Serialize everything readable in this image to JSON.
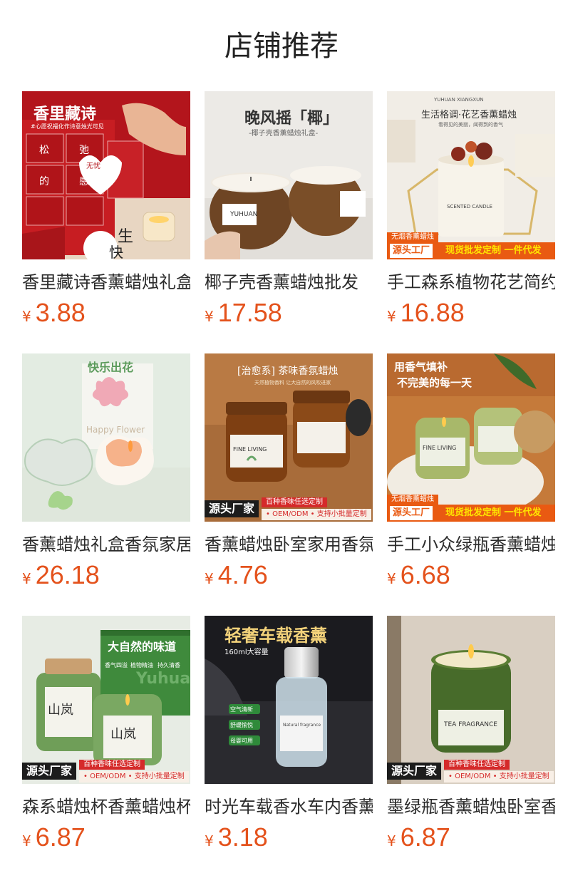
{
  "page": {
    "title": "店铺推荐"
  },
  "currency_symbol": "¥",
  "products": [
    {
      "name": "香里藏诗香薰蜡烛礼盒",
      "price": "3.88",
      "image": {
        "title": "香里藏诗",
        "subtitle": "#心愿祝福化作诗意烛光可见",
        "tiles": [
          "松",
          "弛",
          "的",
          "感",
          "无忧",
          "生",
          "快"
        ]
      }
    },
    {
      "name": "椰子壳香薰蜡烛批发",
      "price": "17.58",
      "image": {
        "title": "晚风摇「椰」",
        "subtitle": "-椰子壳香薰蜡烛礼盒-",
        "jar_label": "YUHUAN"
      }
    },
    {
      "name": "手工森系植物花艺简约",
      "price": "16.88",
      "image": {
        "top_text": "YUHUAN XIANGXUN",
        "title": "生活格调·花艺香薰蜡烛",
        "subtitle": "看得见的美丽，闻得到的香气",
        "jar_label": "SCENTED CANDLE",
        "tag_small": "无烟香薰蜡烛",
        "tag_white": "源头工厂",
        "tag_yellow": "现货批发定制 一件代发"
      }
    },
    {
      "name": "香薰蜡烛礼盒香氛家居",
      "price": "26.18",
      "image": {
        "box_text": "快乐出花",
        "box_en": "Happy Flower"
      }
    },
    {
      "name": "香薰蜡烛卧室家用香氛",
      "price": "4.76",
      "image": {
        "title": "[治愈系] 茶味香氛蜡烛",
        "subtitle": "天然植物香料 让大自然的风吹进家",
        "jar_label": "FINE LIVING",
        "tag_factory": "源头厂家",
        "tag_red": "百种香味任选定制",
        "tag_sub": "• OEM/ODM • 支持小批量定制"
      }
    },
    {
      "name": "手工小众绿瓶香薰蜡烛",
      "price": "6.68",
      "image": {
        "title": "用香气填补",
        "title2": "不完美的每一天",
        "jar_label": "FINE LIVING",
        "tag_small": "无烟香薰蜡烛",
        "tag_white": "源头工厂",
        "tag_yellow": "现货批发定制 一件代发"
      }
    },
    {
      "name": "森系蜡烛杯香薰蜡烛杯",
      "price": "6.87",
      "image": {
        "title": "大自然的味道",
        "chips": [
          "香气四溢",
          "植物精油",
          "持久清香"
        ],
        "jar_label": "山岚",
        "box_text": "Yuhuan",
        "tag_factory": "源头厂家",
        "tag_red": "百种香味任选定制",
        "tag_sub": "• OEM/ODM • 支持小批量定制"
      }
    },
    {
      "name": "时光车载香水车内香薰",
      "price": "3.18",
      "image": {
        "title": "轻奢车载香薰",
        "subtitle": "160ml大容量",
        "chips": [
          "空气清新",
          "舒缓愉悦",
          "母婴可用"
        ],
        "bottle_label": "Natural fragrance"
      }
    },
    {
      "name": "墨绿瓶香薰蜡烛卧室香",
      "price": "6.87",
      "image": {
        "jar_label": "TEA FRAGRANCE",
        "tag_factory": "源头厂家",
        "tag_red": "百种香味任选定制",
        "tag_sub": "• OEM/ODM • 支持小批量定制"
      }
    }
  ]
}
